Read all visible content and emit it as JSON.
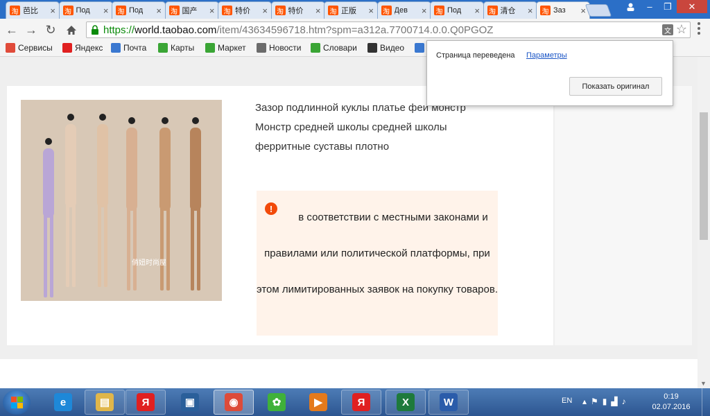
{
  "browser": {
    "tabs": [
      {
        "title": "芭比",
        "active": false
      },
      {
        "title": "Под",
        "active": false
      },
      {
        "title": "Под",
        "active": false
      },
      {
        "title": "国产",
        "active": false
      },
      {
        "title": "特价",
        "active": false
      },
      {
        "title": "特价",
        "active": false
      },
      {
        "title": "正版",
        "active": false
      },
      {
        "title": "Дев",
        "active": false
      },
      {
        "title": "Под",
        "active": false
      },
      {
        "title": "清仓",
        "active": false
      },
      {
        "title": "Заз",
        "active": true
      }
    ],
    "favicon_glyph": "淘",
    "url_scheme": "https://",
    "url_host": "world.taobao.com",
    "url_path": "/item/43634596718.htm?spm=a312a.7700714.0.0.Q0PGOZ",
    "bookmarks": [
      {
        "label": "Сервисы",
        "icon": "apps-icon",
        "color": "#e04b3a"
      },
      {
        "label": "Яндекс",
        "icon": "yandex-icon",
        "color": "#e02020"
      },
      {
        "label": "Почта",
        "icon": "mail-icon",
        "color": "#3a78d0"
      },
      {
        "label": "Карты",
        "icon": "maps-icon",
        "color": "#3aa535"
      },
      {
        "label": "Маркет",
        "icon": "market-icon",
        "color": "#3aa535"
      },
      {
        "label": "Новости",
        "icon": "news-icon",
        "color": "#6b6b6b"
      },
      {
        "label": "Словари",
        "icon": "dict-icon",
        "color": "#3aa535"
      },
      {
        "label": "Видео",
        "icon": "video-icon",
        "color": "#333333"
      },
      {
        "label": "",
        "icon": "audio-icon",
        "color": "#3a78d0"
      }
    ]
  },
  "translate_popup": {
    "status": "Страница переведена",
    "params_link": "Параметры",
    "show_original": "Показать оригинал"
  },
  "product": {
    "image_caption": "俏妞时尚屋",
    "title": "Зазор подлинной куклы платье феи монстр Монстр средней школы средней школы ферритные суставы плотно",
    "notice_icon": "!",
    "notice": "в соответствии с местными законами и правилами или политической платформы, при этом лимитированных заявок на покупку товаров."
  },
  "taskbar": {
    "lang": "EN",
    "time": "0:19",
    "date": "02.07.2016",
    "apps": [
      {
        "name": "ie",
        "glyph": "e",
        "color": "#1e88d8",
        "state": "plain"
      },
      {
        "name": "explorer",
        "glyph": "▤",
        "color": "#e0b64a",
        "state": "pinned"
      },
      {
        "name": "yandex",
        "glyph": "Я",
        "color": "#e02020",
        "state": "pinned"
      },
      {
        "name": "toolbox",
        "glyph": "▣",
        "color": "#2a5f9a",
        "state": "plain"
      },
      {
        "name": "chrome",
        "glyph": "◉",
        "color": "#dd4b39",
        "state": "active"
      },
      {
        "name": "icq",
        "glyph": "✿",
        "color": "#3fb13a",
        "state": "plain"
      },
      {
        "name": "media-player",
        "glyph": "▶",
        "color": "#e47a1c",
        "state": "plain"
      },
      {
        "name": "yandex-browser",
        "glyph": "Я",
        "color": "#e02020",
        "state": "pinned"
      },
      {
        "name": "excel",
        "glyph": "X",
        "color": "#1e7a3c",
        "state": "pinned"
      },
      {
        "name": "word",
        "glyph": "W",
        "color": "#2a5caa",
        "state": "pinned"
      }
    ]
  }
}
